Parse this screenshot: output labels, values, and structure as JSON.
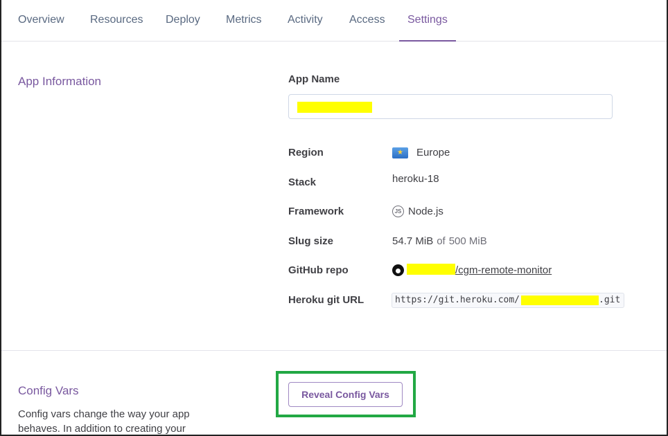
{
  "nav": {
    "tabs": [
      {
        "label": "Overview"
      },
      {
        "label": "Resources"
      },
      {
        "label": "Deploy"
      },
      {
        "label": "Metrics"
      },
      {
        "label": "Activity"
      },
      {
        "label": "Access"
      },
      {
        "label": "Settings",
        "active": true
      }
    ]
  },
  "app_info": {
    "title": "App Information",
    "app_name_label": "App Name",
    "app_name_value": "",
    "region_label": "Region",
    "region_value": "Europe",
    "stack_label": "Stack",
    "stack_value": "heroku-18",
    "framework_label": "Framework",
    "framework_value": "Node.js",
    "slug_label": "Slug size",
    "slug_used": "54.7 MiB",
    "slug_of": "of",
    "slug_total": "500 MiB",
    "github_label": "GitHub repo",
    "github_repo_suffix": "/cgm-remote-monitor",
    "git_url_label": "Heroku git URL",
    "git_url_prefix": "https://git.heroku.com/",
    "git_url_suffix": ".git"
  },
  "config_vars": {
    "title": "Config Vars",
    "reveal_label": "Reveal Config Vars",
    "description": "Config vars change the way your app behaves. In addition to creating your"
  },
  "colors": {
    "accent": "#79589f",
    "highlight": "#22a844",
    "redaction": "#ffff00"
  },
  "icons": {
    "region": "europe-flag-icon",
    "framework": "nodejs-icon",
    "github": "github-icon"
  }
}
